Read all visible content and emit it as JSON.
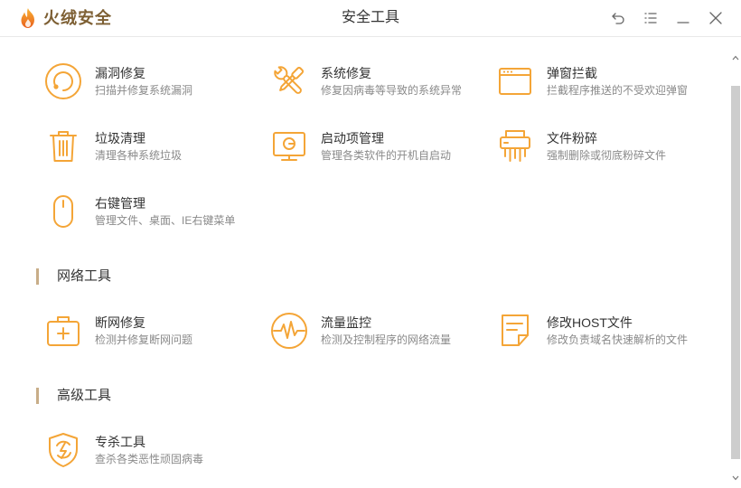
{
  "app": {
    "logo_icon": "flame-logo-icon",
    "logo_text": "火绒安全",
    "window_title": "安全工具"
  },
  "titlebar": {
    "buttons": [
      {
        "icon": "undo-icon"
      },
      {
        "icon": "menu-icon"
      },
      {
        "icon": "minimize-icon"
      },
      {
        "icon": "close-icon"
      }
    ]
  },
  "colors": {
    "accent": "#F4A537",
    "brand": "#7D5F33",
    "marker": "#C8AD88",
    "title": "#333333",
    "desc": "#8A8A8A",
    "thumb": "#CDCDCD"
  },
  "sections": [
    {
      "tools": [
        {
          "name": "漏洞修复",
          "desc": "扫描并修复系统漏洞",
          "icon": "vulnerability-repair-icon"
        },
        {
          "name": "系统修复",
          "desc": "修复因病毒等导致的系统异常",
          "icon": "system-repair-icon"
        },
        {
          "name": "弹窗拦截",
          "desc": "拦截程序推送的不受欢迎弹窗",
          "icon": "popup-block-icon"
        },
        {
          "name": "垃圾清理",
          "desc": "清理各种系统垃圾",
          "icon": "trash-icon"
        },
        {
          "name": "启动项管理",
          "desc": "管理各类软件的开机自启动",
          "icon": "startup-monitor-icon"
        },
        {
          "name": "文件粉碎",
          "desc": "强制删除或彻底粉碎文件",
          "icon": "shredder-icon"
        },
        {
          "name": "右键管理",
          "desc": "管理文件、桌面、IE右键菜单",
          "icon": "mouse-icon"
        }
      ]
    },
    {
      "title": "网络工具",
      "tools": [
        {
          "name": "断网修复",
          "desc": "检测并修复断网问题",
          "icon": "first-aid-kit-icon"
        },
        {
          "name": "流量监控",
          "desc": "检测及控制程序的网络流量",
          "icon": "traffic-pulse-icon"
        },
        {
          "name": "修改HOST文件",
          "desc": "修改负责域名快速解析的文件",
          "icon": "host-file-icon"
        }
      ]
    },
    {
      "title": "高级工具",
      "tools": [
        {
          "name": "专杀工具",
          "desc": "查杀各类恶性顽固病毒",
          "icon": "shield-bolt-icon"
        }
      ]
    }
  ]
}
